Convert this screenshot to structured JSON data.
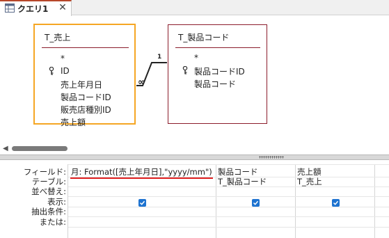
{
  "tab": {
    "label": "クエリ1",
    "close": "✕"
  },
  "tables": [
    {
      "title": "T_売上",
      "fields": [
        "*",
        "ID",
        "売上年月日",
        "製品コードID",
        "販売店種別ID",
        "売上額"
      ],
      "key_field_index": 1
    },
    {
      "title": "T_製品コード",
      "fields": [
        "*",
        "製品コードID",
        "製品コード"
      ],
      "key_field_index": 1
    }
  ],
  "relationship": {
    "one_label": "1",
    "many_label": "∞"
  },
  "grid": {
    "row_headers": [
      "フィールド:",
      "テーブル:",
      "並べ替え:",
      "表示:",
      "抽出条件:",
      "または:"
    ],
    "columns": [
      {
        "field": "月: Format([売上年月日],\"yyyy/mm\")",
        "table": "",
        "show": true
      },
      {
        "field": "製品コード",
        "table": "T_製品コード",
        "show": true
      },
      {
        "field": "売上額",
        "table": "T_売上",
        "show": true
      }
    ]
  },
  "colors": {
    "selected_table_border": "#f5a623",
    "table_border": "#8b1c2b",
    "checkbox": "#1e73d0",
    "highlight_underline": "#e02020"
  }
}
